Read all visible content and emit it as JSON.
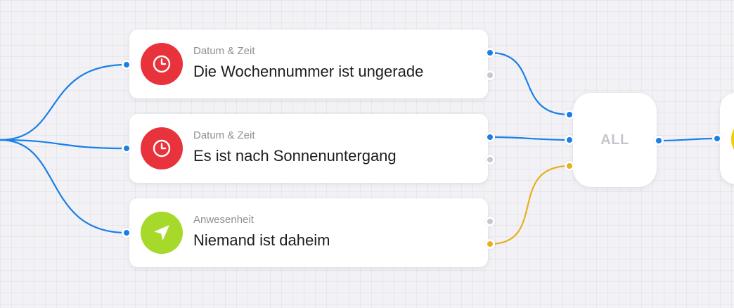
{
  "colors": {
    "wire_true": "#1a7fe6",
    "wire_false": "#e6b020",
    "port_blue": "#1a7fe6",
    "port_gray": "#c7c7cc",
    "port_yellow": "#e6b020",
    "icon_red": "#e8323c",
    "icon_green": "#a6d92a",
    "icon_yellow": "#f5cc00"
  },
  "conditions": [
    {
      "category": "Datum & Zeit",
      "title": "Die Wochennummer ist ungerade",
      "icon": "clock-icon"
    },
    {
      "category": "Datum & Zeit",
      "title": "Es ist nach Sonnenuntergang",
      "icon": "clock-icon"
    },
    {
      "category": "Anwesenheit",
      "title": "Niemand ist daheim",
      "icon": "navigation-arrow-icon"
    }
  ],
  "logic_node": {
    "label": "ALL"
  }
}
